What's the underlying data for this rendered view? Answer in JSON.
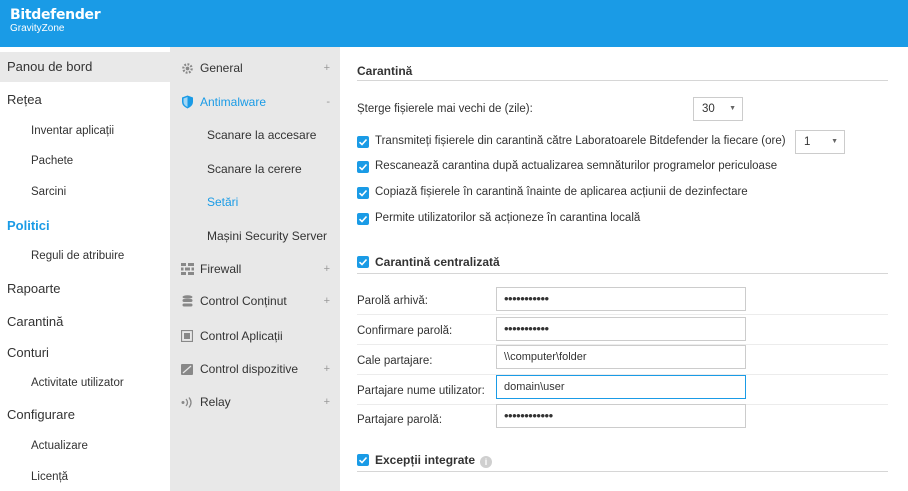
{
  "header": {
    "brand_name": "Bitdefender",
    "brand_sub": "GravityZone",
    "color": "#1a9be6"
  },
  "nav": {
    "items": [
      {
        "label": "Panou de bord"
      },
      {
        "label": "Rețea"
      },
      {
        "label": "Inventar aplicații"
      },
      {
        "label": "Pachete"
      },
      {
        "label": "Sarcini"
      },
      {
        "label": "Politici"
      },
      {
        "label": "Reguli de atribuire"
      },
      {
        "label": "Rapoarte"
      },
      {
        "label": "Carantină"
      },
      {
        "label": "Conturi"
      },
      {
        "label": "Activitate utilizator"
      },
      {
        "label": "Configurare"
      },
      {
        "label": "Actualizare"
      },
      {
        "label": "Licență"
      }
    ]
  },
  "policy_nav": {
    "sections": [
      {
        "label": "General",
        "toggle": "+",
        "icon": "gear-icon"
      },
      {
        "label": "Antimalware",
        "toggle": "-",
        "icon": "shield-icon"
      },
      {
        "label": "Firewall",
        "toggle": "+",
        "icon": "firewall-icon"
      },
      {
        "label": "Control Conținut",
        "toggle": "+",
        "icon": "database-icon"
      },
      {
        "label": "Control Aplicații",
        "toggle": "",
        "icon": "app-control-icon"
      },
      {
        "label": "Control dispozitive",
        "toggle": "+",
        "icon": "device-icon"
      },
      {
        "label": "Relay",
        "toggle": "+",
        "icon": "relay-icon"
      }
    ],
    "antimalware_children": [
      {
        "label": "Scanare la accesare"
      },
      {
        "label": "Scanare la cerere"
      },
      {
        "label": "Setări"
      },
      {
        "label": "Mașini Security Server"
      }
    ]
  },
  "quarantine": {
    "title": "Carantină",
    "delete_label": "Șterge fișierele mai vechi de (zile):",
    "delete_value": "30",
    "options": [
      {
        "label": "Transmiteți fișierele din carantină către Laboratoarele Bitdefender la fiecare (ore)",
        "checked": true
      },
      {
        "label": "Rescanează carantina după actualizarea semnăturilor programelor periculoase",
        "checked": true
      },
      {
        "label": "Copiază fișierele în carantină înainte de aplicarea acțiunii de dezinfectare",
        "checked": true
      },
      {
        "label": "Permite utilizatorilor să acționeze în carantina locală",
        "checked": true
      }
    ],
    "submit_hours_value": "1"
  },
  "central_quarantine": {
    "title": "Carantină centralizată",
    "checked": true,
    "fields": [
      {
        "label": "Parolă arhivă:",
        "value": "•••••••••••"
      },
      {
        "label": "Confirmare parolă:",
        "value": "•••••••••••"
      },
      {
        "label": "Cale partajare:",
        "value": "\\\\computer\\folder"
      },
      {
        "label": "Partajare nume utilizator:",
        "value": "domain\\user"
      },
      {
        "label": "Partajare parolă:",
        "value": "••••••••••••"
      }
    ]
  },
  "exclusions": {
    "title": "Excepții integrate",
    "checked": true,
    "info": "i"
  }
}
